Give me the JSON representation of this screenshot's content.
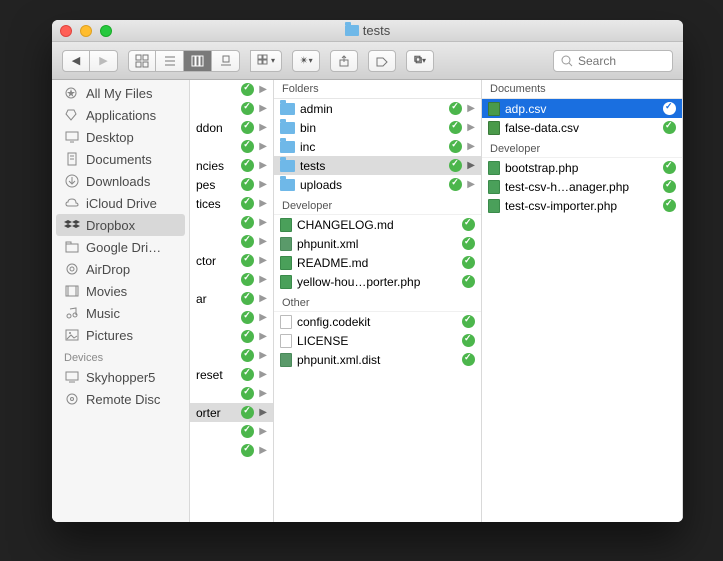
{
  "window": {
    "title": "tests"
  },
  "toolbar": {
    "search_placeholder": "Search"
  },
  "sidebar": {
    "items": [
      {
        "label": "All My Files",
        "icon": "star"
      },
      {
        "label": "Applications",
        "icon": "apps"
      },
      {
        "label": "Desktop",
        "icon": "desktop"
      },
      {
        "label": "Documents",
        "icon": "doc"
      },
      {
        "label": "Downloads",
        "icon": "download"
      },
      {
        "label": "iCloud Drive",
        "icon": "cloud"
      },
      {
        "label": "Dropbox",
        "icon": "dropbox",
        "selected": true
      },
      {
        "label": "Google Dri…",
        "icon": "folder"
      },
      {
        "label": "AirDrop",
        "icon": "airdrop"
      },
      {
        "label": "Movies",
        "icon": "movies"
      },
      {
        "label": "Music",
        "icon": "music"
      },
      {
        "label": "Pictures",
        "icon": "pictures"
      }
    ],
    "devices_header": "Devices",
    "devices": [
      {
        "label": "Skyhopper5",
        "icon": "mac"
      },
      {
        "label": "Remote Disc",
        "icon": "disc"
      }
    ]
  },
  "col0": {
    "items": [
      {
        "label": ""
      },
      {
        "label": ""
      },
      {
        "label": "ddon"
      },
      {
        "label": ""
      },
      {
        "label": "ncies"
      },
      {
        "label": "pes"
      },
      {
        "label": "tices"
      },
      {
        "label": ""
      },
      {
        "label": ""
      },
      {
        "label": "ctor"
      },
      {
        "label": ""
      },
      {
        "label": "ar"
      },
      {
        "label": ""
      },
      {
        "label": ""
      },
      {
        "label": ""
      },
      {
        "label": "reset"
      },
      {
        "label": ""
      },
      {
        "label": "orter",
        "selected": true
      },
      {
        "label": ""
      },
      {
        "label": ""
      }
    ]
  },
  "col1": {
    "header": "Folders",
    "folders": [
      {
        "label": "admin"
      },
      {
        "label": "bin"
      },
      {
        "label": "inc"
      },
      {
        "label": "tests",
        "selected": true
      },
      {
        "label": "uploads"
      }
    ],
    "dev_header": "Developer",
    "dev": [
      {
        "label": "CHANGELOG.md",
        "type": "md"
      },
      {
        "label": "phpunit.xml",
        "type": "xml"
      },
      {
        "label": "README.md",
        "type": "md"
      },
      {
        "label": "yellow-hou…porter.php",
        "type": "php"
      }
    ],
    "other_header": "Other",
    "other": [
      {
        "label": "config.codekit",
        "type": "blank"
      },
      {
        "label": "LICENSE",
        "type": "blank"
      },
      {
        "label": "phpunit.xml.dist",
        "type": "xml"
      }
    ]
  },
  "col2": {
    "header": "Documents",
    "docs": [
      {
        "label": "adp.csv",
        "selected": true
      },
      {
        "label": "false-data.csv"
      }
    ],
    "dev_header": "Developer",
    "dev": [
      {
        "label": "bootstrap.php"
      },
      {
        "label": "test-csv-h…anager.php"
      },
      {
        "label": "test-csv-importer.php"
      }
    ]
  }
}
